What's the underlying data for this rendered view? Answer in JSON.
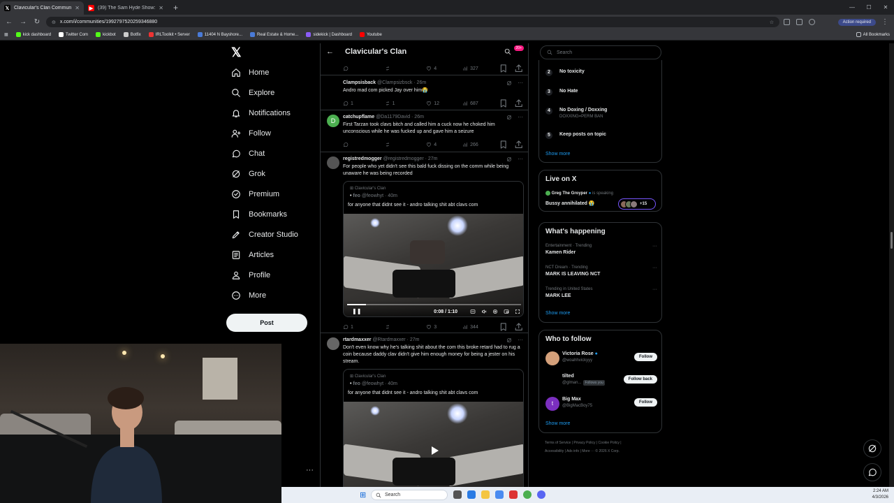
{
  "browser": {
    "tabs": [
      {
        "title": "Clavicular's Clan Community / X",
        "active": true
      },
      {
        "title": "(39) The Sam Hyde Show: Looking",
        "active": false
      }
    ],
    "url": "x.com/i/communities/1992797520259346880",
    "action_required": "Action required",
    "bookmarks": [
      "kick dashboard",
      "Twitter Com",
      "kickbot",
      "Botfix",
      "IRLToolkit • Server",
      "11404 N Bayshore...",
      "Real Estate & Home...",
      "sidekick | Dashboard",
      "Youtube"
    ],
    "all_bookmarks": "All Bookmarks"
  },
  "nav": {
    "items": [
      "Home",
      "Explore",
      "Notifications",
      "Follow",
      "Chat",
      "Grok",
      "Premium",
      "Bookmarks",
      "Creator Studio",
      "Articles",
      "Profile",
      "More"
    ],
    "post": "Post"
  },
  "community": {
    "title": "Clavicular's Clan",
    "badge": "20+"
  },
  "feed": {
    "top_actions": {
      "replies": "",
      "reposts": "",
      "likes": "4",
      "views": "327"
    },
    "tweets": [
      {
        "name": "Clampsisback",
        "handle": "@Clampsizbsck · 26m",
        "text": "Andro mad com picked Jay over him😭",
        "replies": "1",
        "reposts": "1",
        "likes": "12",
        "views": "687",
        "avatar_letter": ""
      },
      {
        "name": "catchupflame",
        "handle": "@Da1179David · 26m",
        "text": "First Tarzan took clavs bitch and called him a cuck now he choked him unconscious while he was fucked up and gave him a seizure",
        "replies": "",
        "reposts": "",
        "likes": "4",
        "views": "266",
        "avatar_letter": "D"
      },
      {
        "name": "registredmogger",
        "handle": "@registredmogger · 27m",
        "text": "For people who yet didn't see this bald fuck dissing on the comm while being unaware he was being recorded",
        "replies": "1",
        "reposts": "",
        "likes": "3",
        "views": "344",
        "avatar_letter": "",
        "quote": {
          "community": "Clavicular's Clan",
          "name": "feo",
          "handle": "@feowhyt · 40m",
          "text": "for anyone that didnt see it - andro talking shit abt clavs com",
          "time": "0:08 / 1:10",
          "progress": 0.11
        }
      },
      {
        "name": "rtardmaxxer",
        "handle": "@Rtardmaxxer · 27m",
        "text": "Don't even know why he's talking shit about the com this broke retard had to rug a coin because daddy clav didn't give him enough money for being a jester on his stream.",
        "avatar_letter": "",
        "quote": {
          "community": "Clavicular's Clan",
          "name": "feo",
          "handle": "@feowhyt · 40m",
          "text": "for anyone that didnt see it - andro talking shit abt clavs com"
        }
      }
    ]
  },
  "right": {
    "search_placeholder": "Search",
    "rules": [
      {
        "n": "2",
        "title": "No toxicity",
        "sub": ""
      },
      {
        "n": "3",
        "title": "No Hate",
        "sub": ""
      },
      {
        "n": "4",
        "title": "No Doxing / Doxxing",
        "sub": "DOXXING=PERM BAN"
      },
      {
        "n": "5",
        "title": "Keep posts on topic",
        "sub": ""
      }
    ],
    "show_more": "Show more",
    "live": {
      "heading": "Live on X",
      "host": "Greg The Groyper",
      "status": "is speaking",
      "title": "Bussy annihilated 😭",
      "count": "+15"
    },
    "happening": {
      "heading": "What's happening",
      "trends": [
        {
          "cat": "Entertainment · Trending",
          "name": "Kamen Rider"
        },
        {
          "cat": "NCT Dream · Trending",
          "name": "MARK IS LEAVING NCT"
        },
        {
          "cat": "Trending in United States",
          "name": "MARK LEE"
        }
      ]
    },
    "wtf": {
      "heading": "Who to follow",
      "users": [
        {
          "name": "Victoria Rose",
          "handle": "@woahhvickyyy",
          "button": "Follow",
          "follows_you": ""
        },
        {
          "name": "tilted",
          "handle": "@glman...",
          "button": "Follow back",
          "follows_you": "Follows you"
        },
        {
          "name": "Big Max",
          "handle": "@BigMacBoy75",
          "button": "Follow",
          "follows_you": ""
        }
      ]
    },
    "footer": [
      "Terms of Service",
      "|",
      "Privacy Policy",
      "|",
      "Cookie Policy",
      "|",
      "Accessibility",
      "|",
      "Ads info",
      "|",
      "More ···",
      "© 2026 X Corp."
    ]
  },
  "taskbar": {
    "search": "Search",
    "time": "2:24 AM",
    "date": "4/3/2026"
  },
  "colors": {
    "accent": "#1d9bf0",
    "bg": "#000000",
    "border": "#2f3336"
  }
}
